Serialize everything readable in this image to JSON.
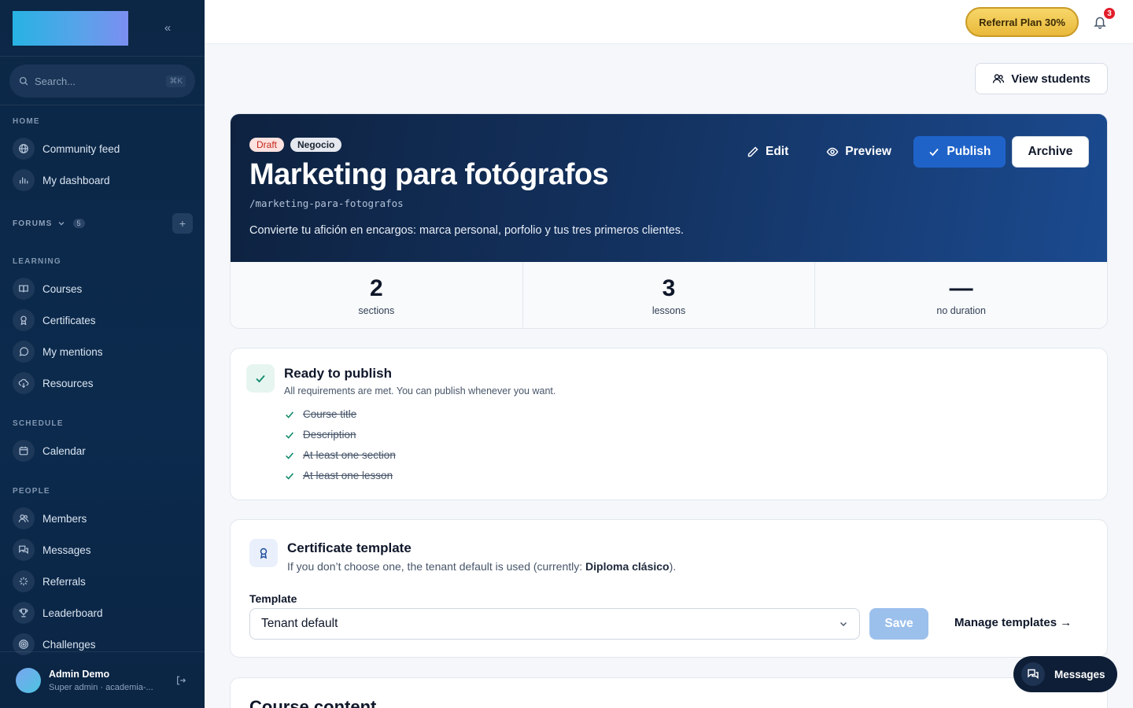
{
  "sidebar": {
    "collapse_label": "«",
    "search": {
      "placeholder": "Search...",
      "shortcut": "⌘K"
    },
    "sections": {
      "home": "HOME",
      "forums": "FORUMS",
      "forums_count": "5",
      "learning": "LEARNING",
      "schedule": "SCHEDULE",
      "people": "PEOPLE"
    },
    "items": {
      "community_feed": "Community feed",
      "my_dashboard": "My dashboard",
      "courses": "Courses",
      "certificates": "Certificates",
      "my_mentions": "My mentions",
      "resources": "Resources",
      "calendar": "Calendar",
      "members": "Members",
      "messages": "Messages",
      "referrals": "Referrals",
      "leaderboard": "Leaderboard",
      "challenges": "Challenges"
    },
    "forum_add": "+",
    "user": {
      "name": "Admin Demo",
      "role": "Super admin · academia-..."
    }
  },
  "topbar": {
    "referral_label": "Referral Plan 30%",
    "notifications_count": "3"
  },
  "actions": {
    "view_students": "View students"
  },
  "course": {
    "status_badge": "Draft",
    "category_badge": "Negocio",
    "title": "Marketing para fotógrafos",
    "slug": "/marketing-para-fotografos",
    "description": "Convierte tu afición en encargos: marca personal, porfolio y tus tres primeros clientes.",
    "edit_label": "Edit",
    "preview_label": "Preview",
    "publish_label": "Publish",
    "archive_label": "Archive"
  },
  "stats": [
    {
      "value": "2",
      "label": "sections"
    },
    {
      "value": "3",
      "label": "lessons"
    },
    {
      "value": "—",
      "label": "no duration"
    }
  ],
  "ready": {
    "title": "Ready to publish",
    "subtitle": "All requirements are met. You can publish whenever you want.",
    "requirements": [
      "Course title",
      "Description",
      "At least one section",
      "At least one lesson"
    ]
  },
  "certificate": {
    "title": "Certificate template",
    "subtitle_prefix": "If you don’t choose one, the tenant default is used (currently: ",
    "subtitle_current": "Diploma clásico",
    "subtitle_suffix": ").",
    "template_label": "Template",
    "selected_template": "Tenant default",
    "save_label": "Save",
    "manage_label": "Manage templates →"
  },
  "course_content": {
    "title": "Course content"
  },
  "messages_fab": {
    "label": "Messages"
  },
  "colors": {
    "sidebar_bg": "#0c2746",
    "accent": "#1f63c9",
    "draft_badge": "#fde2df",
    "success": "#0f8a6a",
    "referral": "#f0c64e"
  }
}
